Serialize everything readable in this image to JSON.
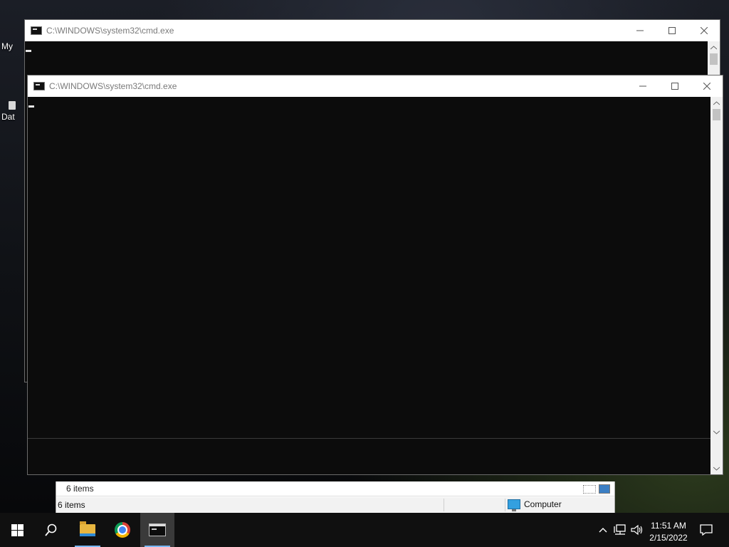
{
  "desktop": {
    "icons": [
      {
        "label": "My"
      },
      {
        "label": "Dat"
      }
    ]
  },
  "windows": {
    "back": {
      "title": "C:\\WINDOWS\\system32\\cmd.exe"
    },
    "front": {
      "title": "C:\\WINDOWS\\system32\\cmd.exe"
    }
  },
  "explorer": {
    "status_top": "6 items",
    "status_bottom": "6 items",
    "location": "Computer"
  },
  "taskbar": {
    "apps": [
      {
        "name": "start",
        "icon": "windows-logo-icon"
      },
      {
        "name": "search",
        "icon": "search-icon"
      },
      {
        "name": "file-explorer",
        "icon": "folder-icon"
      },
      {
        "name": "chrome",
        "icon": "chrome-icon"
      },
      {
        "name": "command-prompt",
        "icon": "cmd-icon",
        "active": true
      }
    ],
    "tray_icons": [
      "chevron-up-icon",
      "network-icon",
      "volume-icon"
    ],
    "time": "11:51 AM",
    "date": "2/15/2022",
    "accent_color": "#7ab8f5"
  }
}
